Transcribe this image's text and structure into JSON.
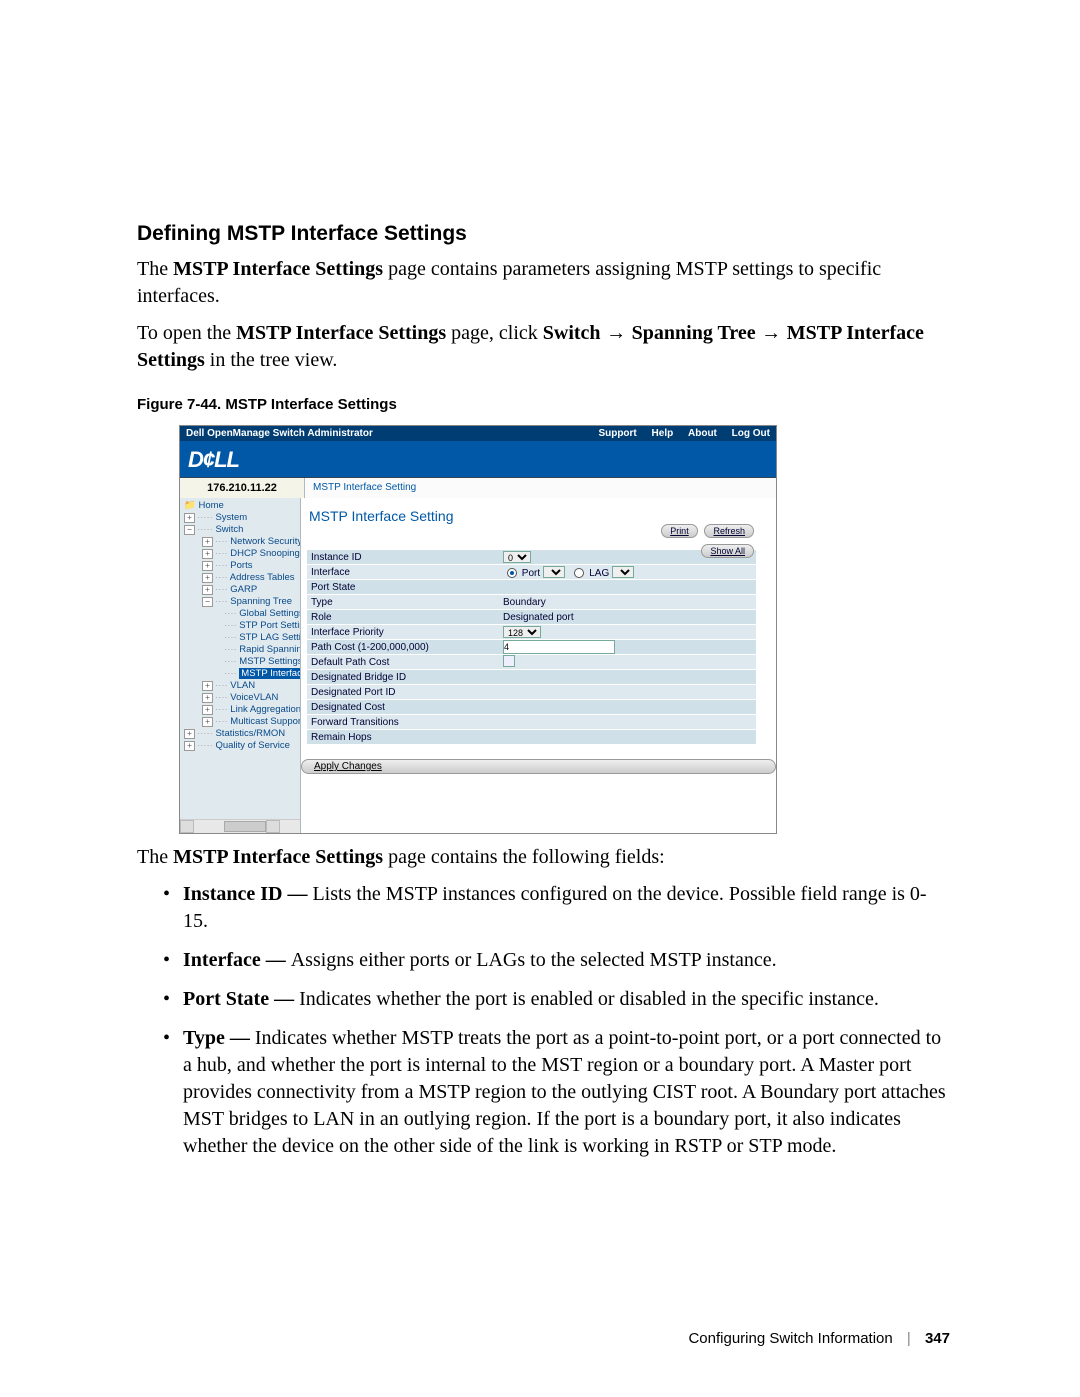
{
  "section_heading": "Defining MSTP Interface Settings",
  "intro_pre": "The ",
  "intro_bold": "MSTP Interface Settings",
  "intro_post": " page contains parameters assigning MSTP settings to specific interfaces.",
  "nav_pre": "To open the ",
  "nav_bold": "MSTP Interface Settings",
  "nav_mid": " page, click ",
  "nav_b1": "Switch",
  "nav_arrow": " → ",
  "nav_b2": "Spanning Tree",
  "nav_b3": "MSTP Interface Settings",
  "nav_post": " in the tree view.",
  "figure_caption": "Figure 7-44.    MSTP Interface Settings",
  "screenshot": {
    "title": "Dell OpenManage Switch Administrator",
    "nav": {
      "support": "Support",
      "help": "Help",
      "about": "About",
      "logout": "Log Out"
    },
    "logo": "D¢LL",
    "ip": "176.210.11.22",
    "breadcrumb": "MSTP Interface Setting",
    "tree": {
      "home": "Home",
      "system": "System",
      "switch": "Switch",
      "items": [
        "Network Security",
        "DHCP Snooping",
        "Ports",
        "Address Tables",
        "GARP",
        "Spanning Tree"
      ],
      "st_children": [
        "Global Settings",
        "STP Port Settings",
        "STP LAG Setting",
        "Rapid Spanning T",
        "MSTP Settings",
        "MSTP Interface"
      ],
      "after": [
        "VLAN",
        "VoiceVLAN",
        "Link Aggregation",
        "Multicast Support"
      ],
      "stats": "Statistics/RMON",
      "qos": "Quality of Service"
    },
    "panel_title": "MSTP Interface Setting",
    "btn_print": "Print",
    "btn_refresh": "Refresh",
    "btn_showall": "Show All",
    "rows": [
      {
        "label": "Instance ID",
        "kind": "select",
        "value": "0"
      },
      {
        "label": "Interface",
        "kind": "iface",
        "port": "Port",
        "lag": "LAG"
      },
      {
        "label": "Port State",
        "kind": "blank",
        "value": ""
      },
      {
        "label": "Type",
        "kind": "text",
        "value": "Boundary"
      },
      {
        "label": "Role",
        "kind": "text",
        "value": "Designated port"
      },
      {
        "label": "Interface Priority",
        "kind": "select",
        "value": "128"
      },
      {
        "label": "Path Cost (1-200,000,000)",
        "kind": "input",
        "value": "4"
      },
      {
        "label": "Default Path Cost",
        "kind": "check",
        "value": ""
      },
      {
        "label": "Designated Bridge ID",
        "kind": "blank",
        "value": ""
      },
      {
        "label": "Designated Port ID",
        "kind": "blank",
        "value": ""
      },
      {
        "label": "Designated Cost",
        "kind": "blank",
        "value": ""
      },
      {
        "label": "Forward Transitions",
        "kind": "blank",
        "value": ""
      },
      {
        "label": "Remain Hops",
        "kind": "blank",
        "value": ""
      }
    ],
    "apply": "Apply Changes"
  },
  "after_pre": "The ",
  "after_bold": "MSTP Interface Settings",
  "after_post": " page contains the following fields:",
  "bullets": [
    {
      "term": "Instance ID — ",
      "desc": "Lists the MSTP instances configured on the device. Possible field range is 0-15."
    },
    {
      "term": "Interface — ",
      "desc": "Assigns either ports or LAGs to the selected MSTP instance."
    },
    {
      "term": "Port State — ",
      "desc": "Indicates whether the port is enabled or disabled in the specific instance."
    },
    {
      "term": "Type — ",
      "desc": "Indicates whether MSTP treats the port as a point-to-point port, or a port connected to a hub, and whether the port is internal to the MST region or a boundary port. A Master port provides connectivity from a MSTP region to the outlying CIST root. A Boundary port attaches MST bridges to LAN in an outlying region. If the port is a boundary port, it also indicates whether the device on the other side of the link is working in RSTP or STP mode."
    }
  ],
  "footer_text": "Configuring Switch Information",
  "footer_page": "347"
}
